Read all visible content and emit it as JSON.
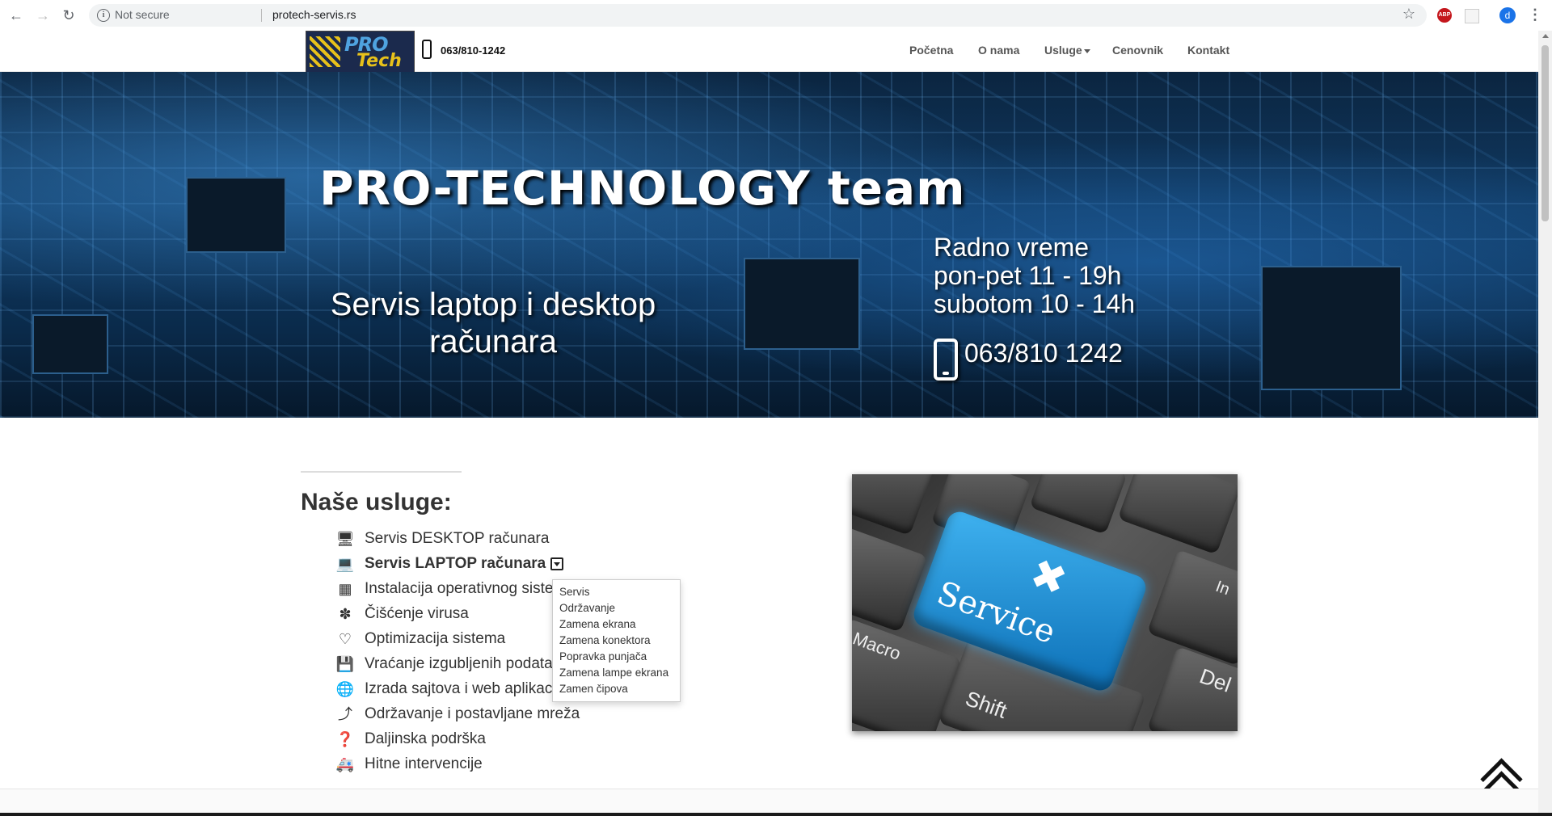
{
  "browser": {
    "security": "Not secure",
    "url": "protech-servis.rs",
    "profile_initial": "d",
    "ext_label": "ABP"
  },
  "header": {
    "logo": {
      "pro": "PRO",
      "tech": "Tech"
    },
    "phone": "063/810-1242",
    "menu": [
      "Početna",
      "O nama",
      "Usluge",
      "Cenovnik",
      "Kontakt"
    ]
  },
  "hero": {
    "title": "PRO-TECHNOLOGY team",
    "subtitle_line1": "Servis laptop i desktop",
    "subtitle_line2": "računara",
    "hours_title": "Radno vreme",
    "hours_weekdays": "pon-pet 11 - 19h",
    "hours_saturday": "subotom 10 - 14h",
    "phone": "063/810 1242"
  },
  "services": {
    "title": "Naše usluge:",
    "items": [
      {
        "label": "Servis DESKTOP računara",
        "icon": "desktop-icon"
      },
      {
        "label": "Servis LAPTOP računara",
        "icon": "laptop-icon"
      },
      {
        "label": "Instalacija operativnog sistema",
        "icon": "windows-icon"
      },
      {
        "label": "Čišćenje virusa",
        "icon": "bug-icon"
      },
      {
        "label": "Optimizacija sistema",
        "icon": "heartbeat-icon"
      },
      {
        "label": "Vraćanje izgubljenih podataka",
        "icon": "floppy-icon"
      },
      {
        "label": "Izrada sajtova i web aplikacija",
        "icon": "globe-icon"
      },
      {
        "label": "Održavanje i postavljane mreža",
        "icon": "rss-icon"
      },
      {
        "label": "Daljinska podrška",
        "icon": "question-icon"
      },
      {
        "label": "Hitne intervencije",
        "icon": "ambulance-icon"
      }
    ],
    "dropdown": [
      "Servis",
      "Održavanje",
      "Zamena ekrana",
      "Zamena konektora",
      "Popravka punjača",
      "Zamena lampe ekrana",
      "Zamen čipova"
    ]
  },
  "image": {
    "key_text": "Service",
    "macro": "Macro",
    "shift": "Shift",
    "del": "Del",
    "in": "In"
  }
}
